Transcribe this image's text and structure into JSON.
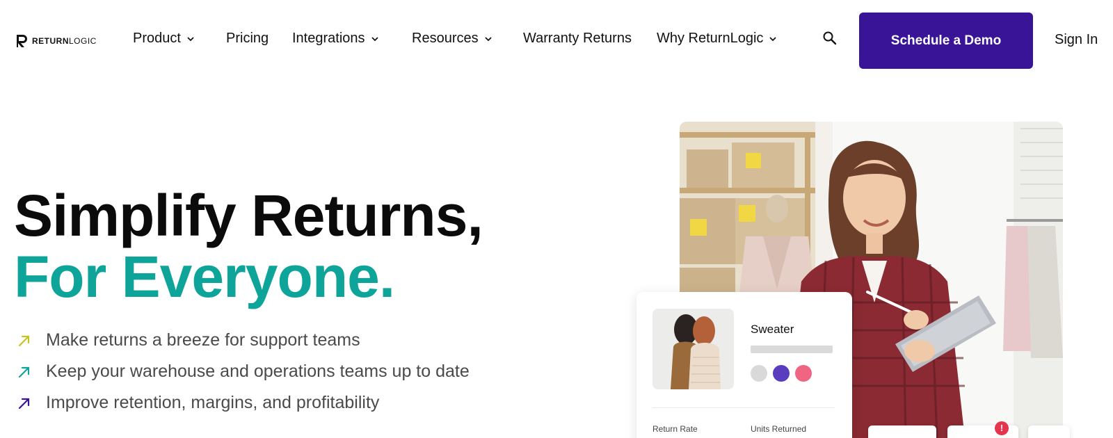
{
  "brand": {
    "logo_bold": "RETURN",
    "logo_light": "LOGIC",
    "accent": "#3a1496",
    "teal": "#0fa49a"
  },
  "nav": {
    "items": [
      {
        "label": "Product",
        "dropdown": true
      },
      {
        "label": "Pricing",
        "dropdown": false
      },
      {
        "label": "Integrations",
        "dropdown": true
      },
      {
        "label": "Resources",
        "dropdown": true
      },
      {
        "label": "Warranty Returns",
        "dropdown": false
      },
      {
        "label": "Why ReturnLogic",
        "dropdown": true
      }
    ],
    "search_icon": "search-icon",
    "cta": "Schedule a Demo",
    "signin": "Sign In"
  },
  "hero": {
    "title_line1": "Simplify Returns,",
    "title_line2": "For Everyone.",
    "bullets": [
      {
        "text": "Make returns a breeze for support teams",
        "color": "#c8c21e"
      },
      {
        "text": "Keep your warehouse and operations teams up to date",
        "color": "#0fa49a"
      },
      {
        "text": "Improve retention, margins, and profitability",
        "color": "#3a1496"
      }
    ]
  },
  "card": {
    "product_name": "Sweater",
    "swatches": [
      "#d9d9d9",
      "#5a3dbf",
      "#f06582"
    ],
    "labels": [
      "Return Rate",
      "Units Returned"
    ],
    "alert_glyph": "!"
  }
}
